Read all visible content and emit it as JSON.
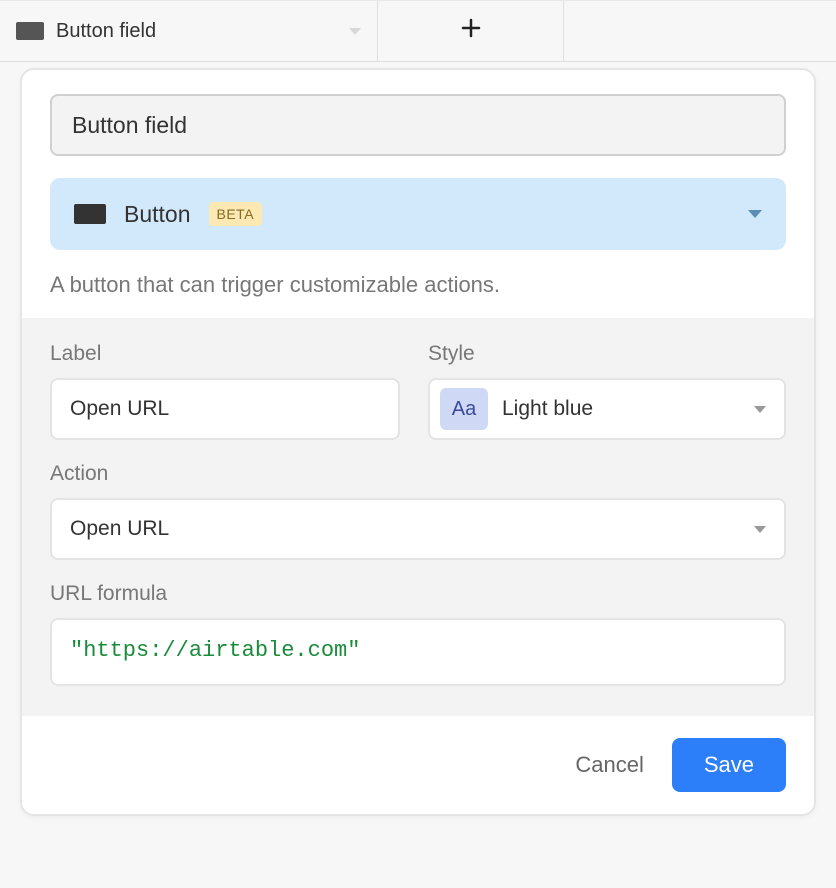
{
  "columns": {
    "field_name": "Button field"
  },
  "popover": {
    "name_value": "Button field",
    "type": {
      "label": "Button",
      "badge": "BETA"
    },
    "description": "A button that can trigger customizable actions.",
    "config": {
      "label_label": "Label",
      "label_value": "Open URL",
      "style_label": "Style",
      "style_value": "Light blue",
      "style_swatch_text": "Aa",
      "action_label": "Action",
      "action_value": "Open URL",
      "formula_label": "URL formula",
      "formula_value": "\"https://airtable.com\""
    },
    "footer": {
      "cancel": "Cancel",
      "save": "Save"
    }
  }
}
